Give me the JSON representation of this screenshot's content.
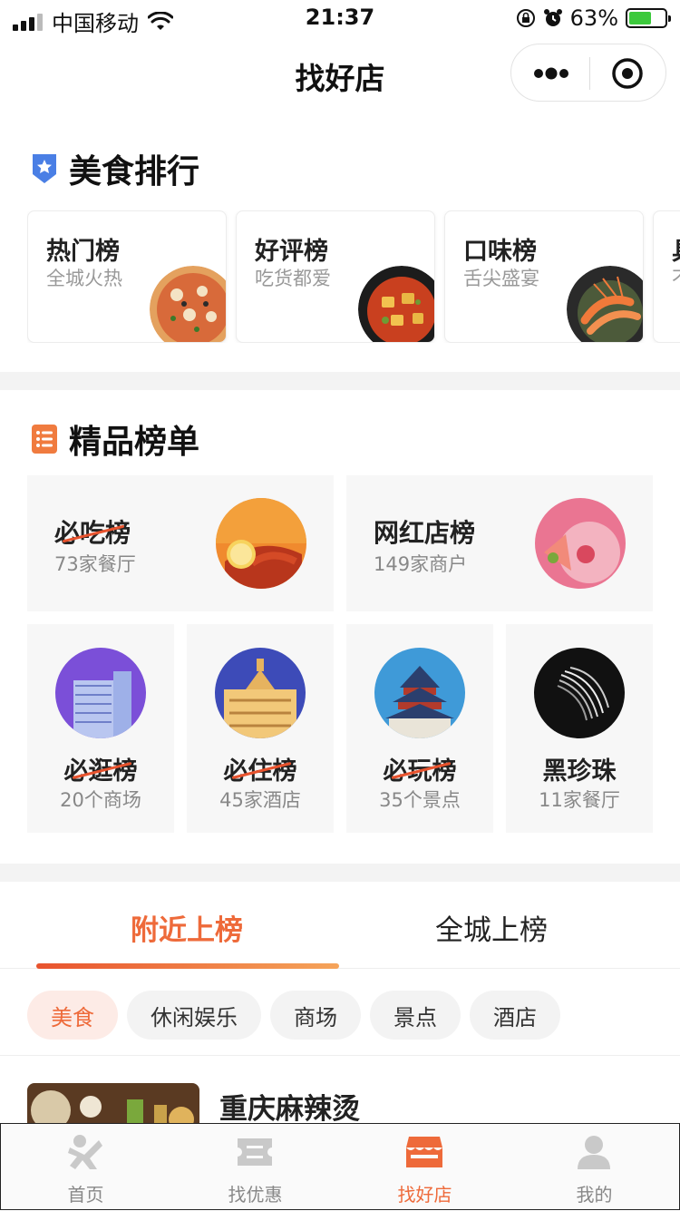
{
  "status_bar": {
    "carrier": "中国移动",
    "time": "21:37",
    "battery": "63%",
    "battery_level": 0.63
  },
  "nav": {
    "title": "找好店"
  },
  "food_ranking": {
    "title": "美食排行",
    "cards": [
      {
        "title": "热门榜",
        "subtitle": "全城火热",
        "image": "pizza"
      },
      {
        "title": "好评榜",
        "subtitle": "吃货都爱",
        "image": "stew"
      },
      {
        "title": "口味榜",
        "subtitle": "舌尖盛宴",
        "image": "shrimp"
      },
      {
        "title": "具",
        "subtitle": "不",
        "image": ""
      }
    ]
  },
  "premium": {
    "title": "精品榜单",
    "big": [
      {
        "logo": "必吃榜",
        "count": "73家餐厅",
        "image": "lobster"
      },
      {
        "logo": "网红店榜",
        "count": "149家商户",
        "image": "dessert"
      }
    ],
    "small": [
      {
        "logo": "必逛榜",
        "count": "20个商场",
        "image": "mall"
      },
      {
        "logo": "必住榜",
        "count": "45家酒店",
        "image": "hotel"
      },
      {
        "logo": "必玩榜",
        "count": "35个景点",
        "image": "temple"
      },
      {
        "logo": "黑珍珠",
        "count": "11家餐厅",
        "image": "pearl"
      }
    ]
  },
  "tabs": {
    "active": "附近上榜",
    "other": "全城上榜"
  },
  "chips": [
    "美食",
    "休闲娱乐",
    "商场",
    "景点",
    "酒店"
  ],
  "list": {
    "first_title": "重庆麻辣烫"
  },
  "tabbar": [
    "首页",
    "找优惠",
    "找好店",
    "我的"
  ],
  "colors": {
    "accent": "#ee6a3a",
    "premium_icon": "#f07b3f",
    "food_icon": "#4a7fe5"
  }
}
